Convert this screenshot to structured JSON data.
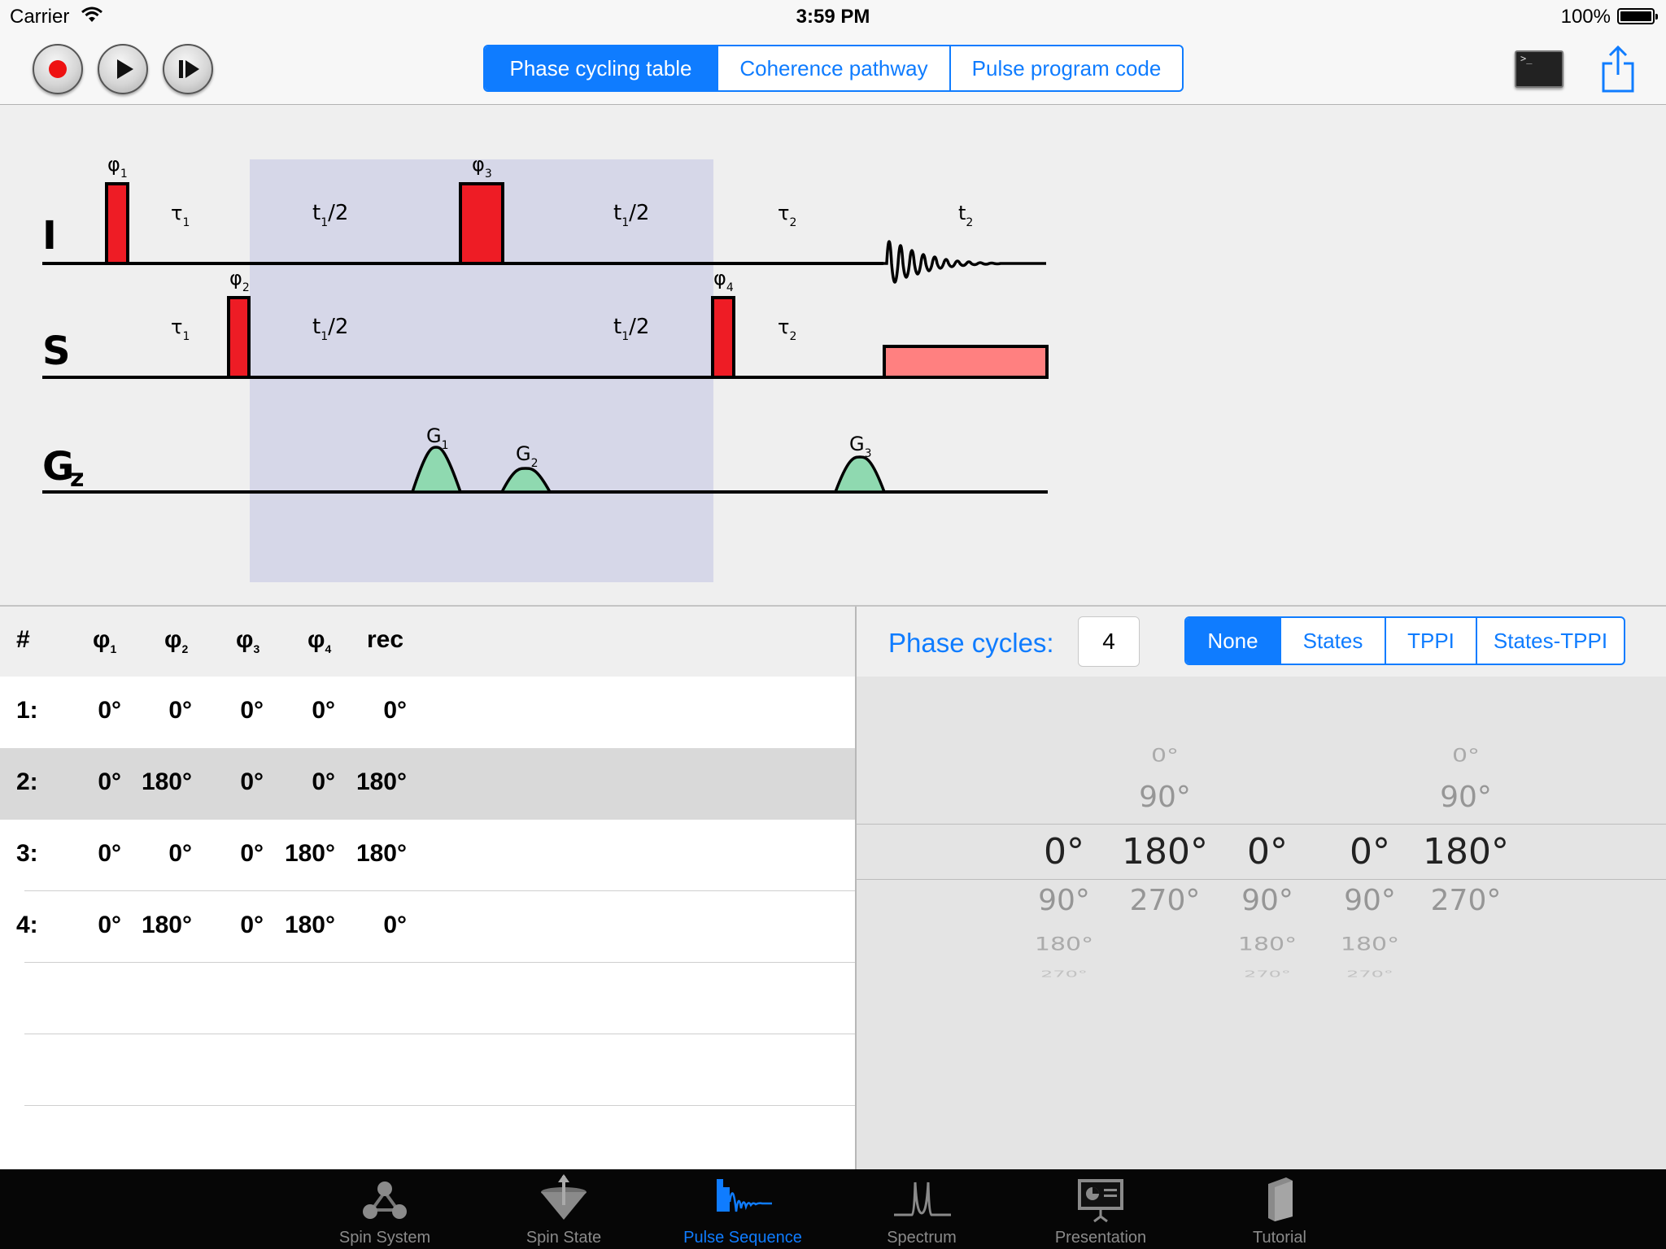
{
  "status_bar": {
    "carrier": "Carrier",
    "time": "3:59 PM",
    "battery": "100%"
  },
  "toolbar": {
    "view_tabs": [
      "Phase cycling table",
      "Coherence pathway",
      "Pulse program code"
    ],
    "selected_view": 0
  },
  "diagram": {
    "channels": [
      "I",
      "S",
      "G"
    ],
    "gz_subscript": "z",
    "pulse_labels": [
      "φ1",
      "φ2",
      "φ3",
      "φ4"
    ],
    "delay_labels": {
      "tau1": "τ1",
      "tau2": "τ2",
      "t1_half": "t1/2",
      "t2": "t2"
    },
    "gradient_labels": [
      "G1",
      "G2",
      "G3"
    ],
    "colors": {
      "pulse": "#ee1c25",
      "decoupling": "#ff8080",
      "gradient": "#8fd9b0",
      "window": "#d6d7e8"
    }
  },
  "phase_table": {
    "columns": [
      "#",
      "φ1",
      "φ2",
      "φ3",
      "φ4",
      "rec"
    ],
    "rows": [
      {
        "idx": "1:",
        "values": [
          "0°",
          "0°",
          "0°",
          "0°",
          "0°"
        ]
      },
      {
        "idx": "2:",
        "values": [
          "0°",
          "180°",
          "0°",
          "0°",
          "180°"
        ]
      },
      {
        "idx": "3:",
        "values": [
          "0°",
          "0°",
          "0°",
          "180°",
          "180°"
        ]
      },
      {
        "idx": "4:",
        "values": [
          "0°",
          "180°",
          "0°",
          "180°",
          "0°"
        ]
      }
    ],
    "selected_row": 1
  },
  "phase_cycles": {
    "label": "Phase cycles:",
    "count": "4",
    "modes": [
      "None",
      "States",
      "TPPI",
      "States-TPPI"
    ],
    "selected_mode": 0
  },
  "picker": {
    "c1": {
      "selected": "0°",
      "below": [
        "90°",
        "180°",
        "270°"
      ]
    },
    "c2": {
      "above": [
        "0°",
        "90°"
      ],
      "selected": "180°",
      "below": [
        "270°"
      ]
    },
    "c3": {
      "selected": "0°",
      "below": [
        "90°",
        "180°",
        "270°"
      ]
    },
    "c4": {
      "selected": "0°",
      "below": [
        "90°",
        "180°",
        "270°"
      ]
    },
    "c5": {
      "above": [
        "0°",
        "90°"
      ],
      "selected": "180°",
      "below": [
        "270°"
      ]
    }
  },
  "tab_bar": {
    "items": [
      "Spin System",
      "Spin State",
      "Pulse Sequence",
      "Spectrum",
      "Presentation",
      "Tutorial"
    ],
    "active": 2
  }
}
